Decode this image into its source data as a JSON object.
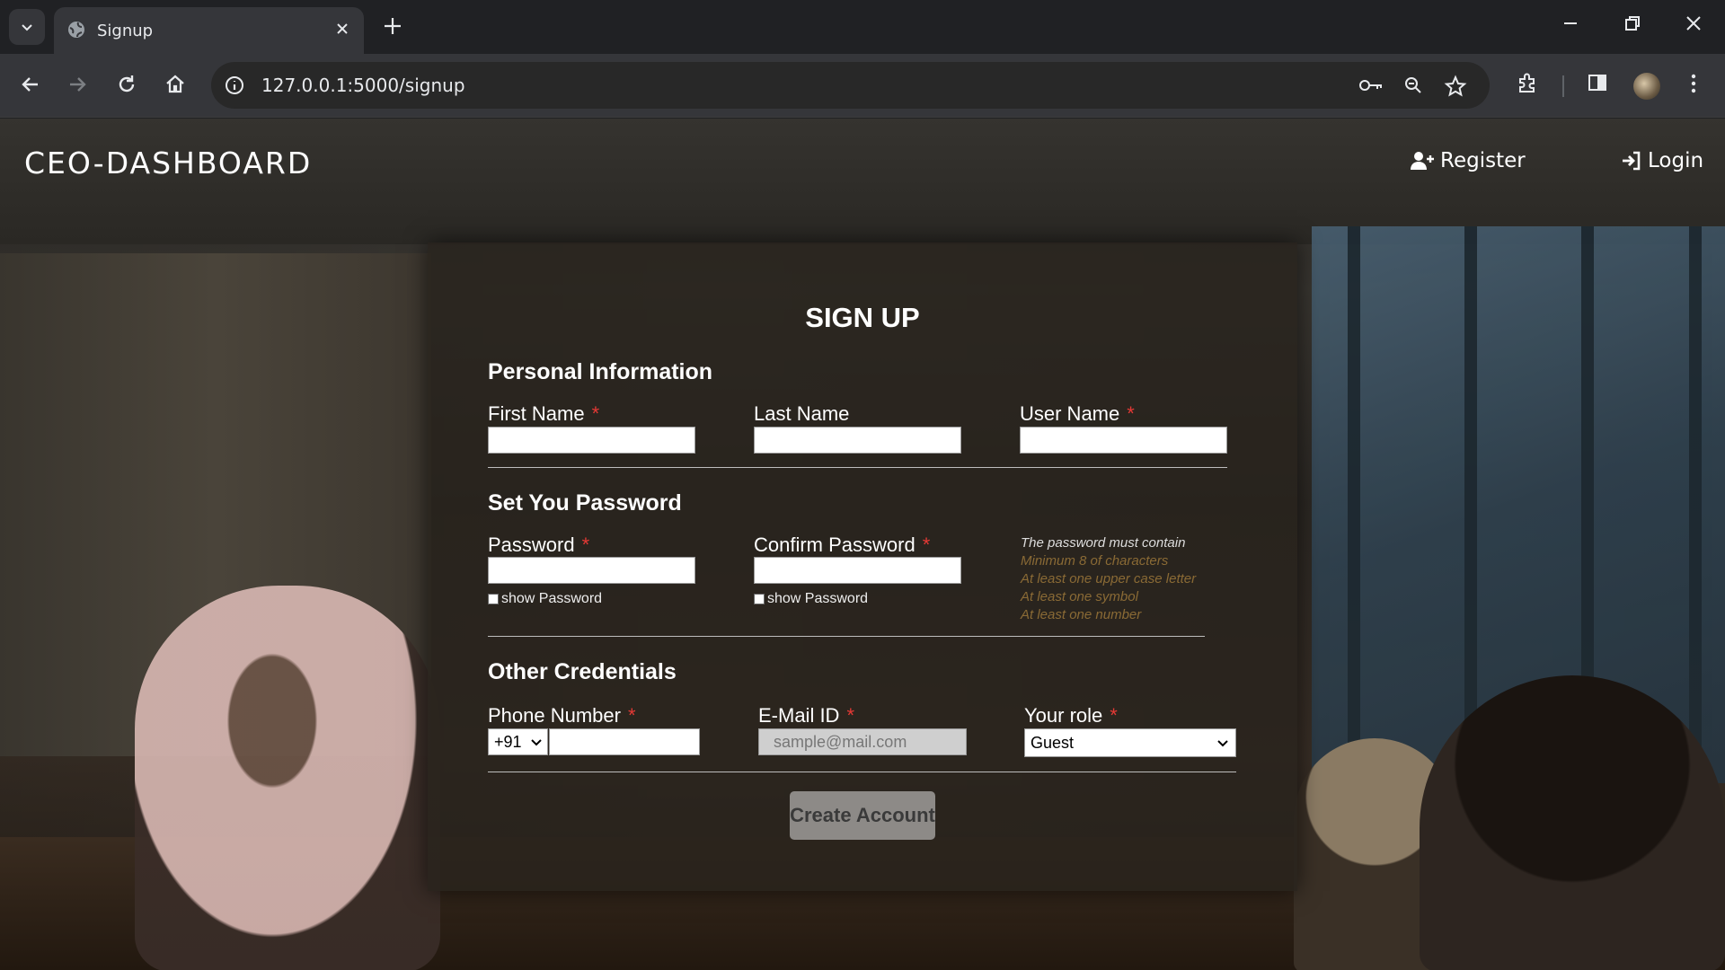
{
  "browser": {
    "tab_title": "Signup",
    "url": "127.0.0.1:5000/signup"
  },
  "nav": {
    "brand": "CEO-DASHBOARD",
    "register": "Register",
    "login": "Login"
  },
  "form": {
    "title": "SIGN UP",
    "personal_section": "Personal Information",
    "first_name_label": "First Name",
    "last_name_label": "Last Name",
    "user_name_label": "User Name",
    "password_section": "Set You Password",
    "password_label": "Password",
    "confirm_password_label": "Confirm Password",
    "show_password": "show Password",
    "password_hints": {
      "heading": "The password must contain",
      "items": [
        "Minimum 8 of characters",
        "At least one upper case letter",
        "At least one symbol",
        "At least one number"
      ]
    },
    "other_section": "Other Credentials",
    "phone_label": "Phone Number",
    "country_code": "+91",
    "email_label": "E-Mail ID",
    "email_placeholder": "sample@mail.com",
    "role_label": "Your role",
    "role_value": "Guest",
    "required_mark": "*",
    "submit": "Create Account"
  },
  "colors": {
    "required": "#e53935",
    "hint_heading": "#dddddd",
    "hint_item": "#8a6a35"
  }
}
